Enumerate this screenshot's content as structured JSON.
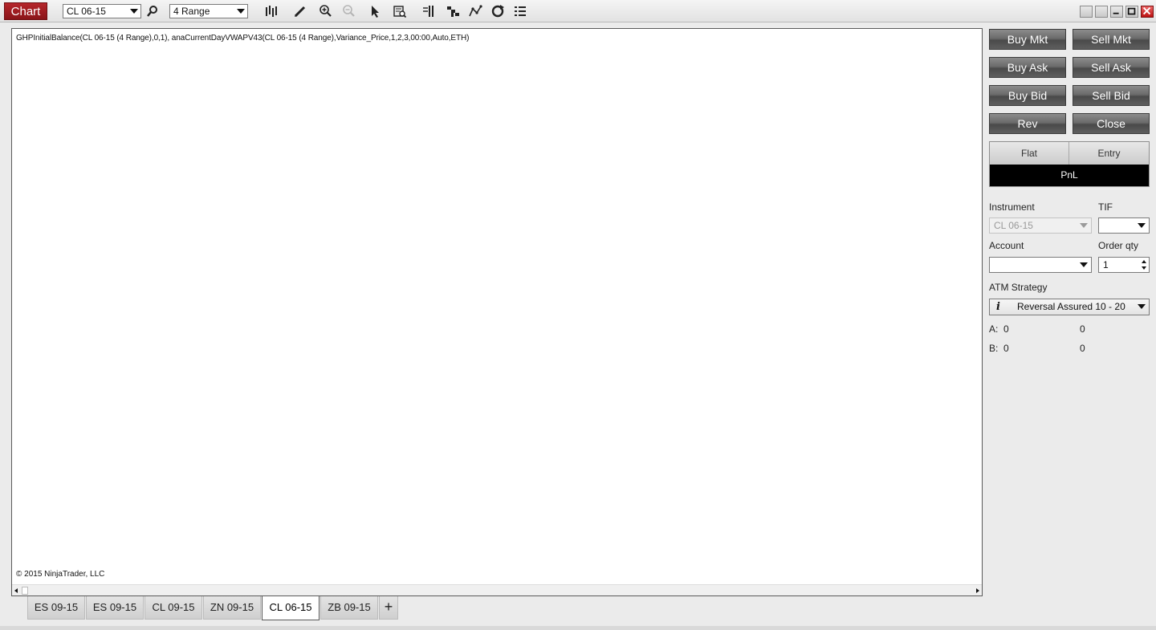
{
  "toolbar": {
    "chart_label": "Chart",
    "instrument_value": "CL 06-15",
    "period_value": "4 Range",
    "icons": [
      "search-icon",
      "bar-style-icon",
      "pencil-icon",
      "zoom-in-icon",
      "zoom-out-icon",
      "pointer-icon",
      "data-box-icon",
      "bar-spacing-icon",
      "stair-icon",
      "indicators-icon",
      "reload-icon",
      "properties-icon"
    ],
    "window_icons": [
      "tile-icon",
      "tile-icon",
      "minimize-icon",
      "maximize-icon",
      "close-icon"
    ]
  },
  "chart": {
    "indicator_label": "GHPInitialBalance(CL 06-15 (4 Range),0,1), anaCurrentDayVWAPV43(CL 06-15 (4 Range),Variance_Price,1,2,3,00:00,Auto,ETH)",
    "copyright": "© 2015 NinjaTrader, LLC"
  },
  "tabs": {
    "items": [
      {
        "label": "ES 09-15",
        "active": false
      },
      {
        "label": "ES 09-15",
        "active": false
      },
      {
        "label": "CL 09-15",
        "active": false
      },
      {
        "label": "ZN 09-15",
        "active": false
      },
      {
        "label": "CL 06-15",
        "active": true
      },
      {
        "label": "ZB 09-15",
        "active": false
      }
    ],
    "add_label": "+"
  },
  "order_panel": {
    "buttons": {
      "buy_mkt": "Buy Mkt",
      "sell_mkt": "Sell Mkt",
      "buy_ask": "Buy Ask",
      "sell_ask": "Sell Ask",
      "buy_bid": "Buy Bid",
      "sell_bid": "Sell Bid",
      "rev": "Rev",
      "close": "Close"
    },
    "position": {
      "flat": "Flat",
      "entry": "Entry",
      "pnl": "PnL"
    },
    "instrument_label": "Instrument",
    "instrument_value": "CL 06-15",
    "tif_label": "TIF",
    "tif_value": "",
    "account_label": "Account",
    "account_value": "",
    "order_qty_label": "Order qty",
    "order_qty_value": "1",
    "atm_label": "ATM Strategy",
    "atm_info": "i",
    "atm_value": "Reversal Assured 10 - 20",
    "stats": {
      "a_label": "A:",
      "a_value1": "0",
      "a_value2": "0",
      "b_label": "B:",
      "b_value1": "0",
      "b_value2": "0"
    }
  },
  "colors": {
    "chart_badge": "#9e1d22",
    "button_dark": "#5a5a5a",
    "pnl_bg": "#000000"
  }
}
